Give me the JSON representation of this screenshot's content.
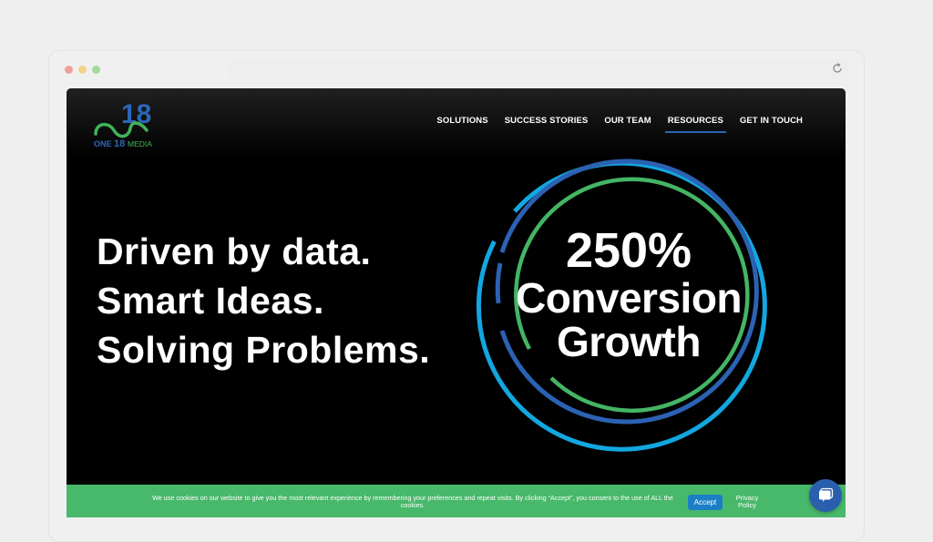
{
  "browser": {
    "controls": [
      "close",
      "minimize",
      "maximize"
    ],
    "reload_icon": "reload-icon"
  },
  "site": {
    "logo": {
      "text_one": "ONE",
      "text_18": "18",
      "text_media": "MEDIA",
      "colors": {
        "green": "#3fb45a",
        "blue": "#2a66b8"
      }
    },
    "nav": [
      {
        "label": "SOLUTIONS",
        "active": false
      },
      {
        "label": "SUCCESS STORIES",
        "active": false
      },
      {
        "label": "OUR TEAM",
        "active": false
      },
      {
        "label": "RESOURCES",
        "active": true
      },
      {
        "label": "GET IN TOUCH",
        "active": false
      }
    ],
    "hero": {
      "lines": [
        "Driven by data.",
        "Smart Ideas.",
        "Solving Problems."
      ],
      "stat_value": "250%",
      "stat_label_1": "Conversion",
      "stat_label_2": "Growth",
      "ring_colors": {
        "outer": "#12a7e0",
        "middle": "#2b62b3",
        "inner": "#44b564"
      }
    },
    "cookie_banner": {
      "text": "We use cookies on our website to give you the most relevant experience by remembering your preferences and repeat visits. By clicking “Accept”, you consent to the use of ALL the cookies.",
      "accept_label": "Accept",
      "privacy_label": "Privacy Policy",
      "background": "#48b86a"
    },
    "chat": {
      "icon": "chat-icon"
    }
  }
}
